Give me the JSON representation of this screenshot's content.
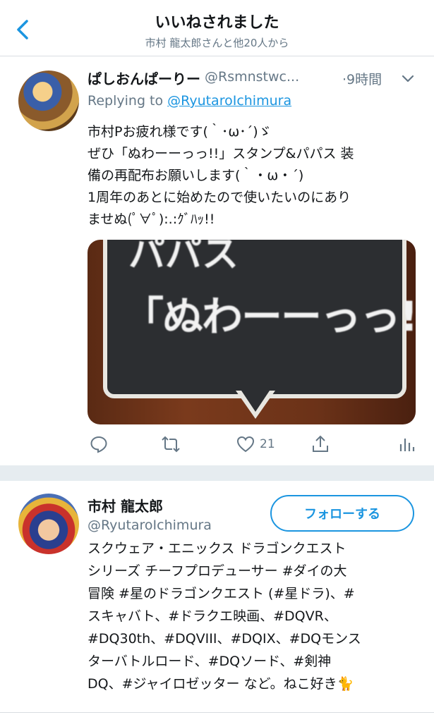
{
  "header": {
    "title": "いいねされました",
    "subtitle": "市村 龍太郎さんと他20人から"
  },
  "tweet": {
    "author_name": "ぱしおんぱーりー",
    "author_handle": "@Rsmnstwc...",
    "time": "·9時間",
    "replying_prefix": "Replying to ",
    "replying_to": "@RyutaroIchimura",
    "body_lines": [
      "市村Pお疲れ様です(｀･ω･´)ゞ",
      "ぜひ「ぬわーーっっ!!」スタンプ&パパス 装",
      "備の再配布お願いします(｀・ω・´)",
      "1周年のあとに始めたので使いたいのにあり",
      "ませぬ(ﾟ∀ﾟ):.:ｸﾞﾊｯ!!"
    ],
    "media_text_line1": "パパス",
    "media_text_line2": "「ぬわーーっっ!!",
    "like_count": "21",
    "icons": [
      "reply-icon",
      "retweet-icon",
      "heart-icon",
      "share-icon",
      "analytics-icon"
    ]
  },
  "profile": {
    "name": "市村 龍太郎",
    "handle": "@RyutaroIchimura",
    "follow_label": "フォローする",
    "bio_lines": [
      "スクウェア・エニックス ドラゴンクエスト",
      "シリーズ チーフプロデューサー #ダイの大",
      "冒険 #星のドラゴンクエスト (#星ドラ)、#",
      "スキャバト、#ドラクエ映画、#DQVR、",
      "#DQ30th、#DQVIII、#DQIX、#DQモンス",
      "ターバトルロード、#DQソード、#剣神",
      "DQ、#ジャイロゼッター など。ねこ好き🐈"
    ]
  },
  "colors": {
    "accent": "#1b95e0",
    "secondary_text": "#657786",
    "separator": "#e6ecf0"
  }
}
